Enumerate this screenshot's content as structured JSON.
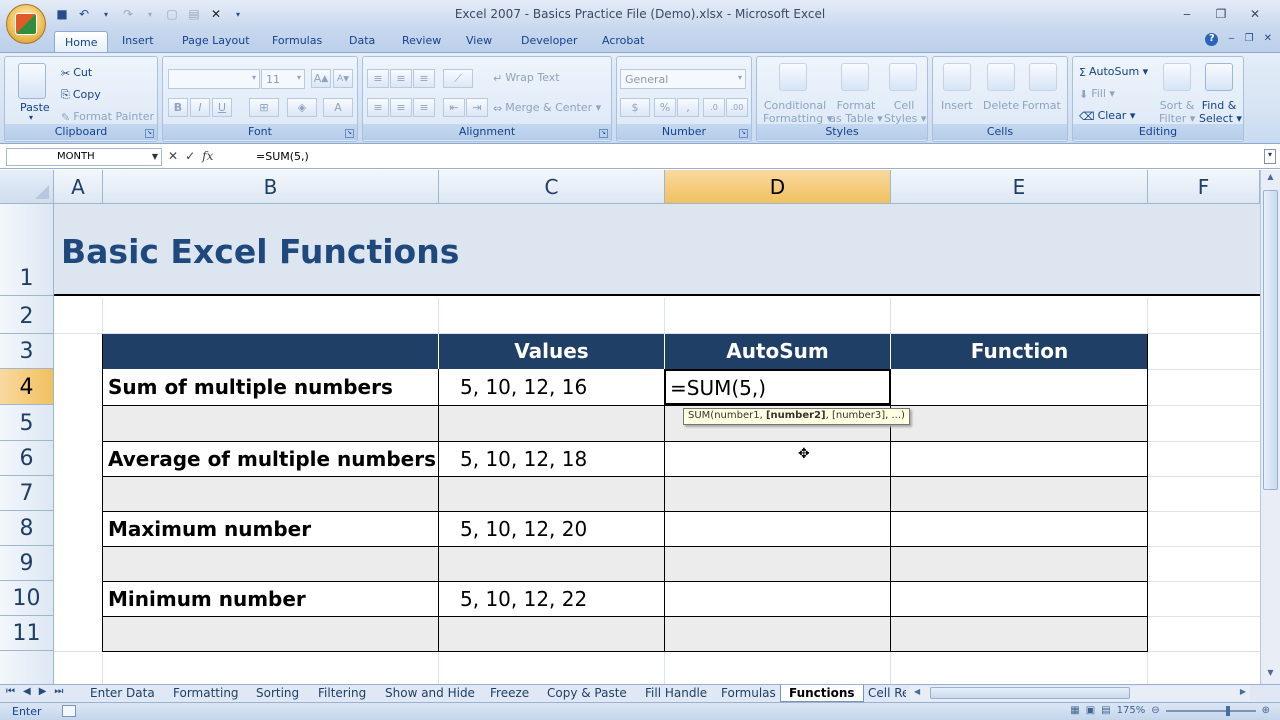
{
  "window": {
    "title": "Excel 2007 - Basics Practice File (Demo).xlsx - Microsoft Excel"
  },
  "ribbon_tabs": [
    "Home",
    "Insert",
    "Page Layout",
    "Formulas",
    "Data",
    "Review",
    "View",
    "Developer",
    "Acrobat"
  ],
  "clipboard": {
    "paste": "Paste",
    "cut": "Cut",
    "copy": "Copy",
    "format_painter": "Format Painter",
    "group": "Clipboard"
  },
  "font": {
    "size": "11",
    "group": "Font",
    "grow": "A",
    "shrink": "A",
    "bold": "B",
    "italic": "I",
    "underline": "U"
  },
  "alignment": {
    "wrap": "Wrap Text",
    "merge": "Merge & Center",
    "group": "Alignment"
  },
  "number": {
    "format": "General",
    "currency": "$",
    "percent": "%",
    "comma": ",",
    "group": "Number"
  },
  "styles": {
    "conditional_1": "Conditional",
    "conditional_2": "Formatting",
    "format_table_1": "Format",
    "format_table_2": "as Table",
    "cell_styles_1": "Cell",
    "cell_styles_2": "Styles",
    "group": "Styles"
  },
  "cells": {
    "insert": "Insert",
    "delete": "Delete",
    "format": "Format",
    "group": "Cells"
  },
  "editing": {
    "autosum": "AutoSum",
    "fill": "Fill",
    "clear": "Clear",
    "sort_1": "Sort &",
    "sort_2": "Filter",
    "find_1": "Find &",
    "find_2": "Select",
    "group": "Editing"
  },
  "formula_bar": {
    "name_box": "MONTH",
    "fx": "fx",
    "formula": "=SUM(5,)"
  },
  "columns": [
    "A",
    "B",
    "C",
    "D",
    "E",
    "F"
  ],
  "rows": [
    "1",
    "2",
    "3",
    "4",
    "5",
    "6",
    "7",
    "8",
    "9",
    "10",
    "11"
  ],
  "sheet": {
    "title": "Basic Excel Functions",
    "headers": {
      "values": "Values",
      "autosum": "AutoSum",
      "function": "Function"
    },
    "rows": [
      {
        "label": "Sum of multiple numbers",
        "values": "5, 10, 12, 16"
      },
      {
        "label": "Average of multiple numbers",
        "values": "5, 10, 12, 18"
      },
      {
        "label": "Maximum number",
        "values": "5, 10, 12, 20"
      },
      {
        "label": "Minimum number",
        "values": "5, 10, 12, 22"
      }
    ],
    "editing_cell": "=SUM(5,)",
    "tooltip": {
      "fn": "SUM(number1, ",
      "bold": "[number2]",
      "rest": ", [number3], ...)"
    }
  },
  "sheet_tabs": [
    "Enter Data",
    "Formatting",
    "Sorting",
    "Filtering",
    "Show and Hide",
    "Freeze",
    "Copy & Paste",
    "Fill Handle",
    "Formulas",
    "Functions",
    "Cell Re"
  ],
  "active_sheet": "Functions",
  "status": {
    "mode": "Enter",
    "zoom": "175%"
  }
}
